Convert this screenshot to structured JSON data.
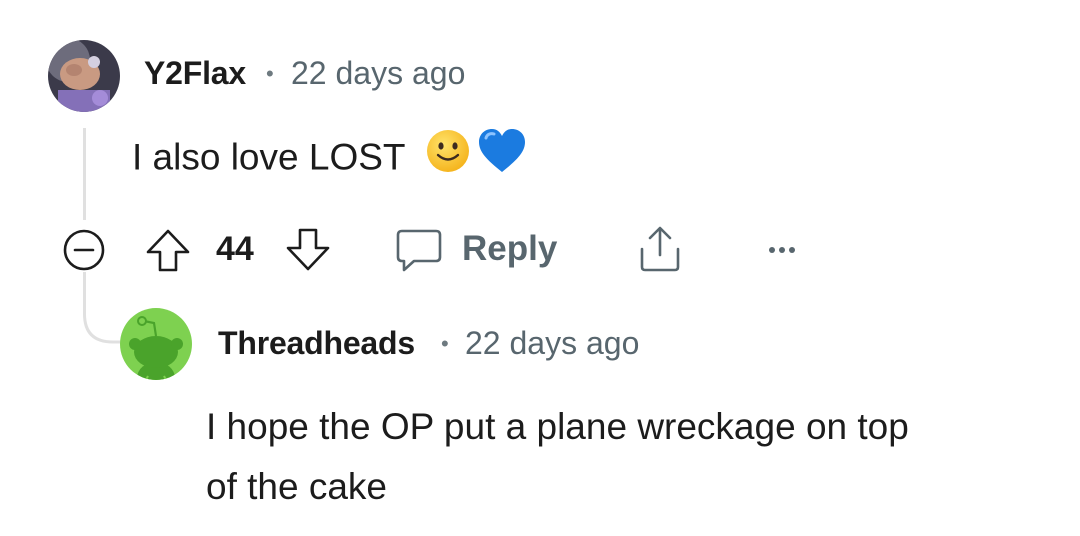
{
  "comment": {
    "author": "Y2Flax",
    "separator": "•",
    "time": "22 days ago",
    "text": "I also love LOST",
    "emojis": [
      "slightly-smiling-face-emoji",
      "blue-heart-emoji"
    ],
    "votes": "44",
    "reply_label": "Reply"
  },
  "reply": {
    "author": "Threadheads",
    "separator": "•",
    "time": "22 days ago",
    "text_line1": "I hope the OP put a plane wreckage on top",
    "text_line2": "of the cake"
  },
  "colors": {
    "reply_avatar_bg": "#7ed150",
    "snoo": "#4aa32b",
    "blue_heart": "#1b7be0",
    "smile": "#f8c52c"
  },
  "icons": [
    "collapse-icon",
    "upvote-icon",
    "downvote-icon",
    "comment-icon",
    "share-icon",
    "more-options-icon",
    "snoo-icon"
  ]
}
